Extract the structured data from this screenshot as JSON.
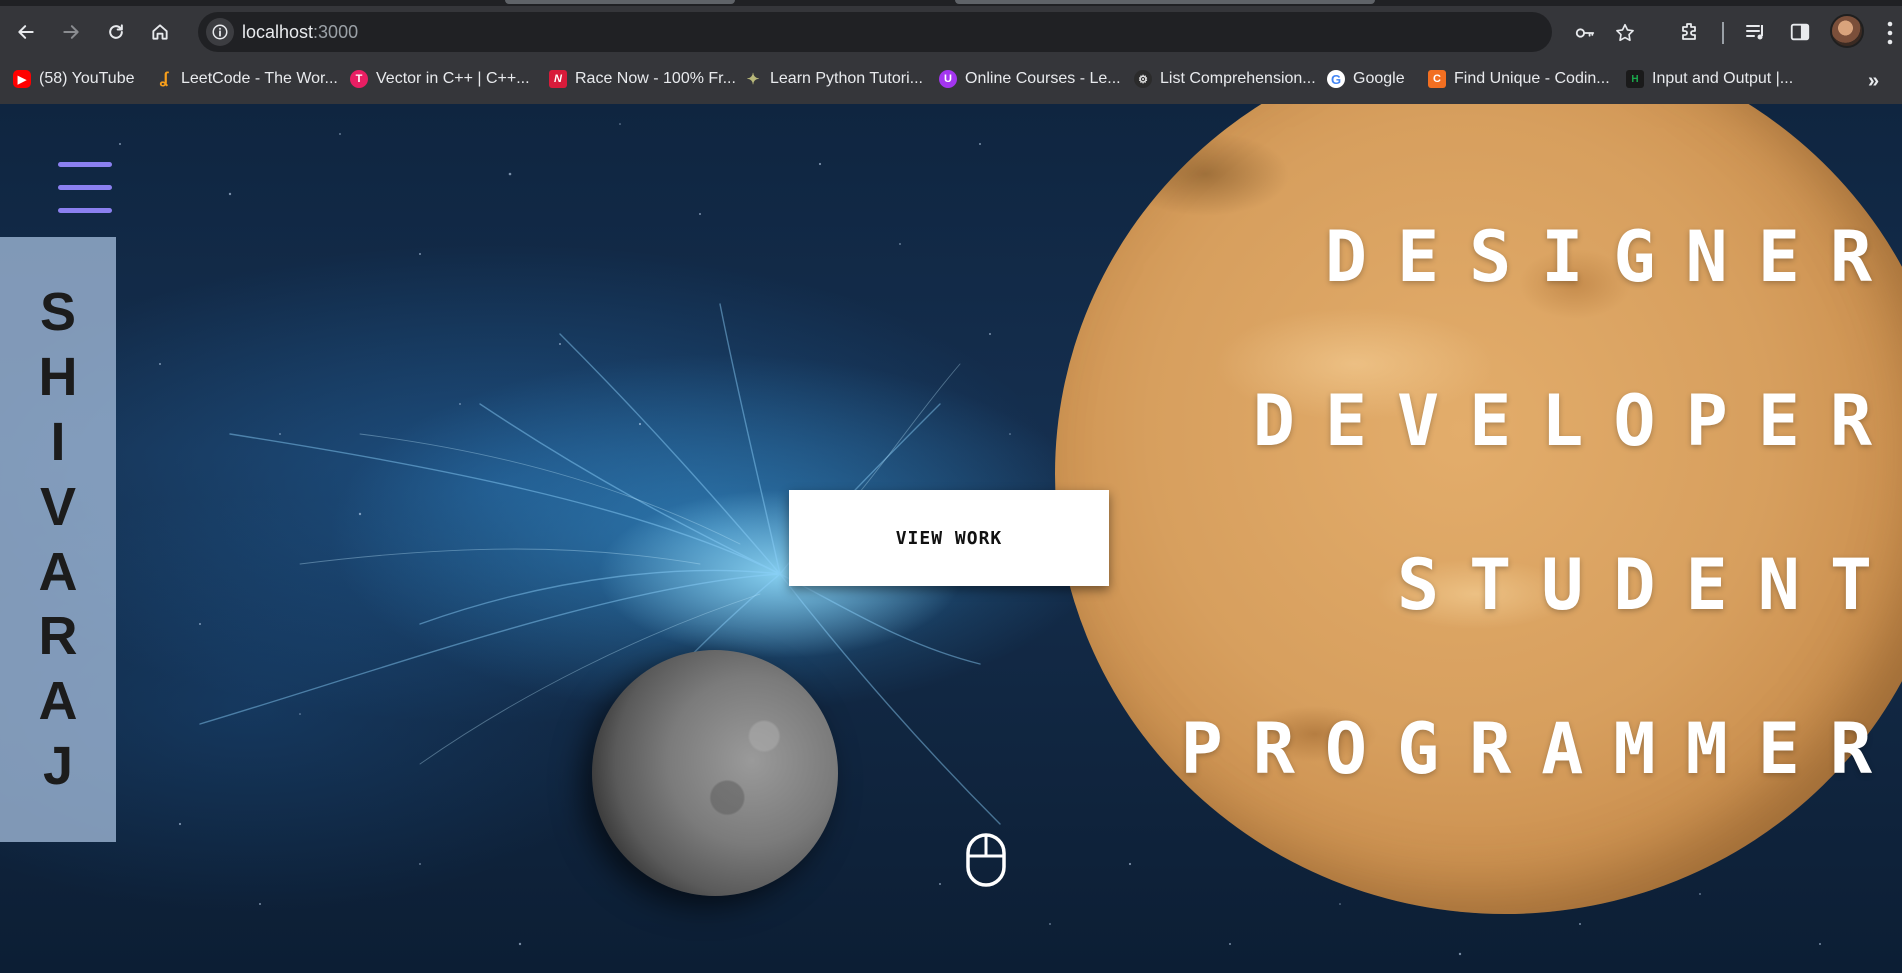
{
  "browser": {
    "url_host": "localhost",
    "url_port": ":3000",
    "bookmarks": [
      {
        "label": "(58) YouTube",
        "icon": "youtube-icon",
        "color": "#ff0000"
      },
      {
        "label": "LeetCode - The Wor...",
        "icon": "leetcode-icon",
        "color": "#f89f1b"
      },
      {
        "label": "Vector in C++ | C++...",
        "icon": "tutorial-site-icon",
        "color": "#e91e63"
      },
      {
        "label": "Race Now - 100% Fr...",
        "icon": "nitro-type-icon",
        "color": "#d81b3a"
      },
      {
        "label": "Learn Python Tutori...",
        "icon": "python-tutorial-icon",
        "color": "#8a8a5c"
      },
      {
        "label": "Online Courses - Le...",
        "icon": "udemy-icon",
        "color": "#a435f0"
      },
      {
        "label": "List Comprehension...",
        "icon": "gfg-gear-icon",
        "color": "#444444"
      },
      {
        "label": "Google",
        "icon": "google-icon",
        "color": "#4285f4"
      },
      {
        "label": "Find Unique - Codin...",
        "icon": "coding-ninjas-icon",
        "color": "#f26f21"
      },
      {
        "label": "Input and Output |...",
        "icon": "hackerrank-icon",
        "color": "#1ba94c"
      }
    ]
  },
  "page": {
    "name_letters": [
      "S",
      "H",
      "I",
      "V",
      "A",
      "R",
      "A",
      "J"
    ],
    "roles": [
      "DESIGNER",
      "DEVELOPER",
      "STUDENT",
      "PROGRAMMER"
    ],
    "view_work_label": "VIEW WORK",
    "accent_color": "#8b80f0"
  }
}
